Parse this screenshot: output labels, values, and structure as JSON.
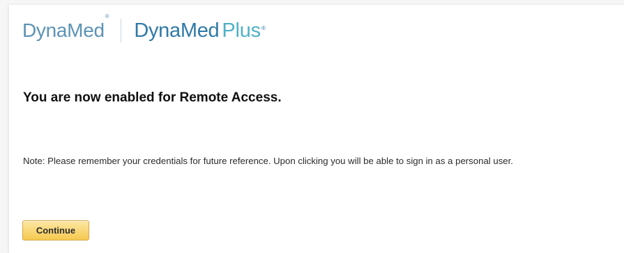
{
  "brand": {
    "logo_dynamed": "DynaMed",
    "logo_dynamed_plus": "DynaMed",
    "logo_plus": "Plus",
    "trademark": "®",
    "colors": {
      "dynamed": "#5c93b3",
      "dynamed_plus": "#2f7aa8",
      "plus": "#4fb0c6"
    }
  },
  "main": {
    "headline": "You are now enabled for Remote Access.",
    "note": "Note: Please remember your credentials for future reference. Upon clicking you will be able to sign in as a personal user.",
    "continue_label": "Continue"
  },
  "colors": {
    "button_top": "#fde7a4",
    "button_bottom": "#f6c94f",
    "button_border": "#d7a64a"
  }
}
